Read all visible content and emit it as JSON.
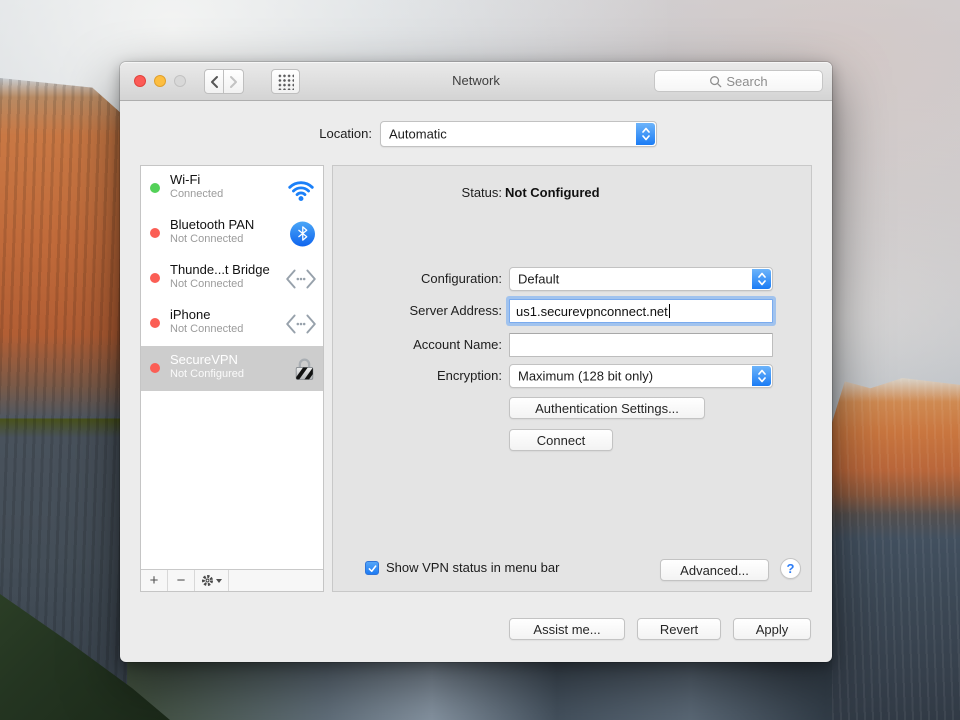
{
  "titlebar": {
    "title": "Network",
    "search_placeholder": "Search"
  },
  "location": {
    "label": "Location:",
    "value": "Automatic"
  },
  "sidebar": {
    "items": [
      {
        "name": "Wi-Fi",
        "status": "Connected",
        "dot": "green",
        "icon": "wifi-icon",
        "selected": false
      },
      {
        "name": "Bluetooth PAN",
        "status": "Not Connected",
        "dot": "red",
        "icon": "bluetooth-icon",
        "selected": false
      },
      {
        "name": "Thunde...t Bridge",
        "status": "Not Connected",
        "dot": "red",
        "icon": "bridge-icon",
        "selected": false
      },
      {
        "name": "iPhone",
        "status": "Not Connected",
        "dot": "red",
        "icon": "bridge-icon",
        "selected": false
      },
      {
        "name": "SecureVPN",
        "status": "Not Configured",
        "dot": "red",
        "icon": "vpn-lock-icon",
        "selected": true
      }
    ],
    "add_label": "+",
    "remove_label": "−"
  },
  "panel": {
    "status_label": "Status:",
    "status_value": "Not Configured",
    "configuration_label": "Configuration:",
    "configuration_value": "Default",
    "server_label": "Server Address:",
    "server_value": "us1.securevpnconnect.net",
    "account_label": "Account Name:",
    "account_value": "",
    "encryption_label": "Encryption:",
    "encryption_value": "Maximum (128 bit only)",
    "auth_button": "Authentication Settings...",
    "connect_button": "Connect",
    "checkbox_label": "Show VPN status in menu bar",
    "checkbox_checked": true,
    "advanced_button": "Advanced...",
    "help_label": "?"
  },
  "footer": {
    "assist_button": "Assist me...",
    "revert_button": "Revert",
    "apply_button": "Apply"
  },
  "colors": {
    "accent_blue": "#1b7cf5",
    "selected_row": "#cdcdcd",
    "green_dot": "#53d158",
    "red_dot": "#fb5e55",
    "window_bg": "#ececec",
    "panel_bg": "#e4e4e4",
    "cliff_orange": "#c06a3a",
    "rock_slate": "#49525c",
    "trees_green": "#243521"
  }
}
